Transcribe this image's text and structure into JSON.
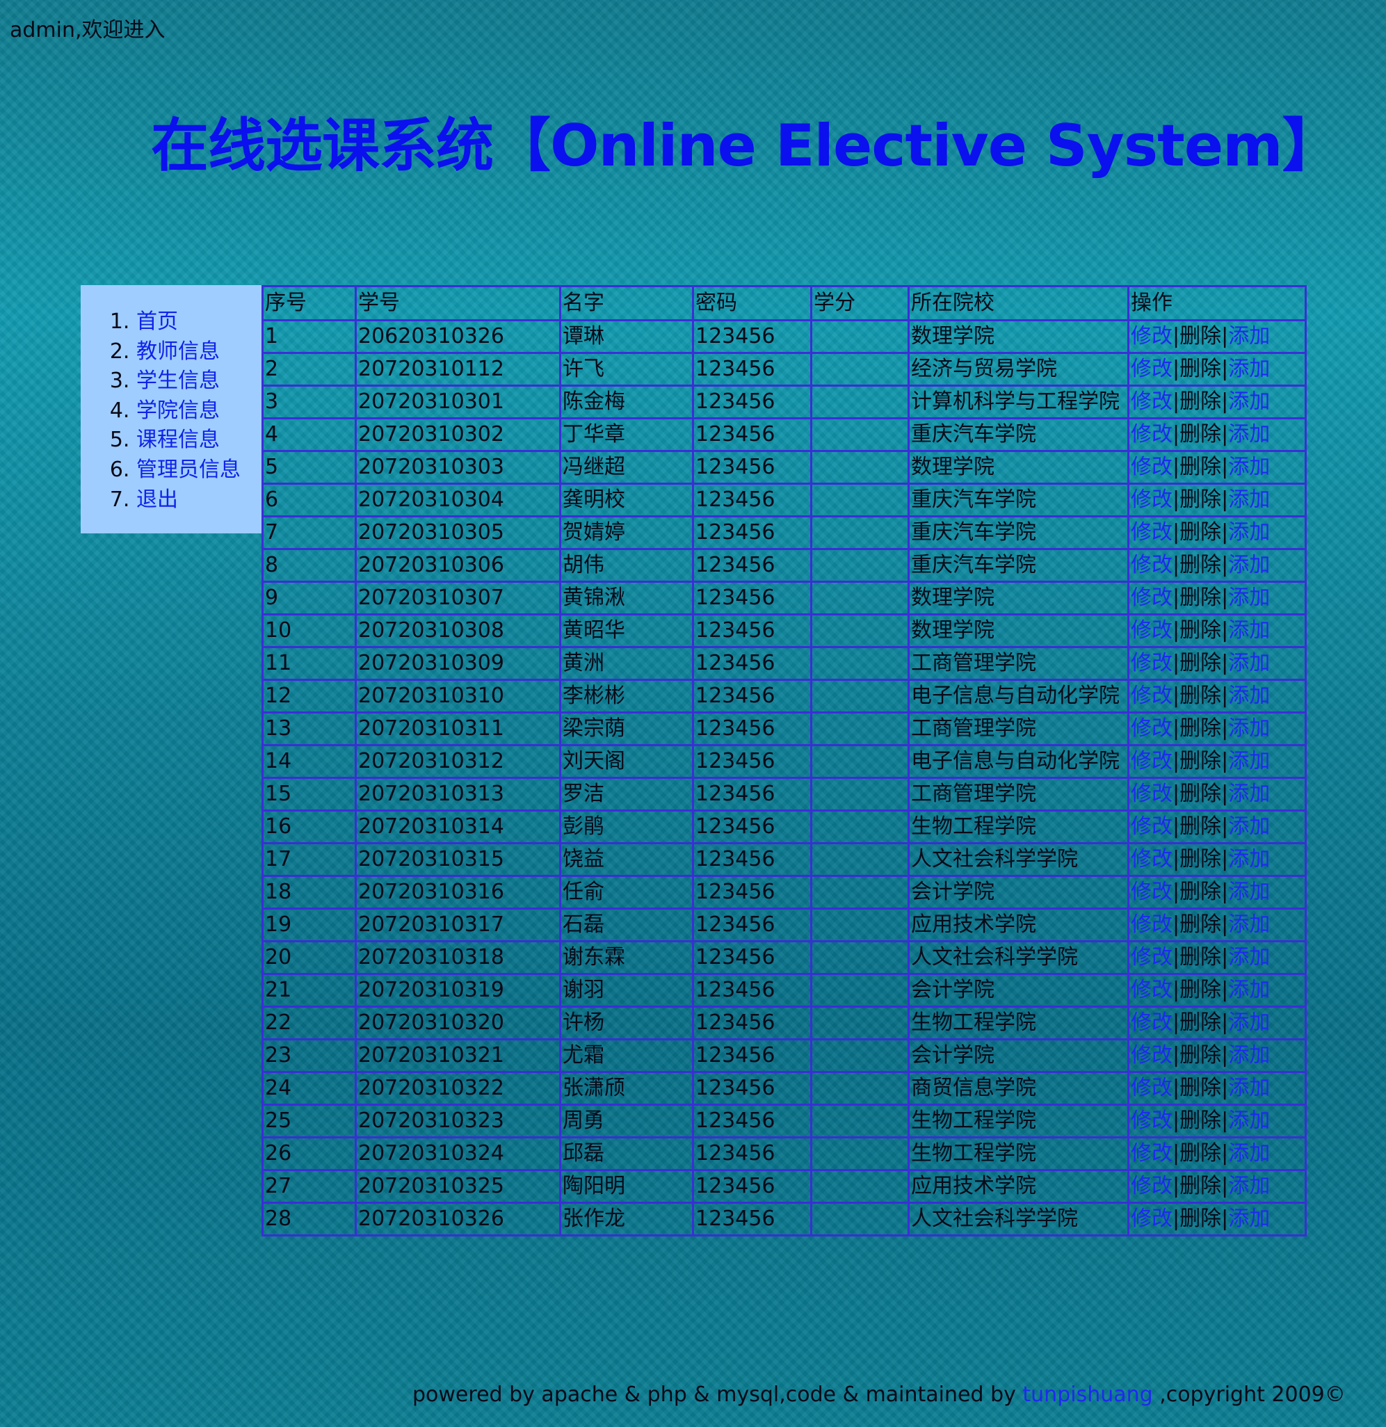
{
  "welcome_text": "admin,欢迎进入",
  "page_title": "在线选课系统【Online Elective System】",
  "sidebar": {
    "items": [
      {
        "label": "首页"
      },
      {
        "label": "教师信息"
      },
      {
        "label": "学生信息"
      },
      {
        "label": "学院信息"
      },
      {
        "label": "课程信息"
      },
      {
        "label": "管理员信息"
      },
      {
        "label": "退出"
      }
    ]
  },
  "table": {
    "headers": [
      "序号",
      "学号",
      "名字",
      "密码",
      "学分",
      "所在院校",
      "操作"
    ],
    "actions": {
      "edit": "修改",
      "separator": "|",
      "delete": "删除",
      "add": "添加"
    },
    "rows": [
      {
        "no": "1",
        "id": "20620310326",
        "name": "谭琳",
        "password": "123456",
        "credit": "",
        "college": "数理学院"
      },
      {
        "no": "2",
        "id": "20720310112",
        "name": "许飞",
        "password": "123456",
        "credit": "",
        "college": "经济与贸易学院"
      },
      {
        "no": "3",
        "id": "20720310301",
        "name": "陈金梅",
        "password": "123456",
        "credit": "",
        "college": "计算机科学与工程学院"
      },
      {
        "no": "4",
        "id": "20720310302",
        "name": "丁华章",
        "password": "123456",
        "credit": "",
        "college": "重庆汽车学院"
      },
      {
        "no": "5",
        "id": "20720310303",
        "name": "冯继超",
        "password": "123456",
        "credit": "",
        "college": "数理学院"
      },
      {
        "no": "6",
        "id": "20720310304",
        "name": "龚明校",
        "password": "123456",
        "credit": "",
        "college": "重庆汽车学院"
      },
      {
        "no": "7",
        "id": "20720310305",
        "name": "贺婧婷",
        "password": "123456",
        "credit": "",
        "college": "重庆汽车学院"
      },
      {
        "no": "8",
        "id": "20720310306",
        "name": "胡伟",
        "password": "123456",
        "credit": "",
        "college": "重庆汽车学院"
      },
      {
        "no": "9",
        "id": "20720310307",
        "name": "黄锦湫",
        "password": "123456",
        "credit": "",
        "college": "数理学院"
      },
      {
        "no": "10",
        "id": "20720310308",
        "name": "黄昭华",
        "password": "123456",
        "credit": "",
        "college": "数理学院"
      },
      {
        "no": "11",
        "id": "20720310309",
        "name": "黄洲",
        "password": "123456",
        "credit": "",
        "college": "工商管理学院"
      },
      {
        "no": "12",
        "id": "20720310310",
        "name": "李彬彬",
        "password": "123456",
        "credit": "",
        "college": "电子信息与自动化学院"
      },
      {
        "no": "13",
        "id": "20720310311",
        "name": "梁宗荫",
        "password": "123456",
        "credit": "",
        "college": "工商管理学院"
      },
      {
        "no": "14",
        "id": "20720310312",
        "name": "刘天阁",
        "password": "123456",
        "credit": "",
        "college": "电子信息与自动化学院"
      },
      {
        "no": "15",
        "id": "20720310313",
        "name": "罗洁",
        "password": "123456",
        "credit": "",
        "college": "工商管理学院"
      },
      {
        "no": "16",
        "id": "20720310314",
        "name": "彭鹃",
        "password": "123456",
        "credit": "",
        "college": "生物工程学院"
      },
      {
        "no": "17",
        "id": "20720310315",
        "name": "饶益",
        "password": "123456",
        "credit": "",
        "college": "人文社会科学学院"
      },
      {
        "no": "18",
        "id": "20720310316",
        "name": "任俞",
        "password": "123456",
        "credit": "",
        "college": "会计学院"
      },
      {
        "no": "19",
        "id": "20720310317",
        "name": "石磊",
        "password": "123456",
        "credit": "",
        "college": "应用技术学院"
      },
      {
        "no": "20",
        "id": "20720310318",
        "name": "谢东霖",
        "password": "123456",
        "credit": "",
        "college": "人文社会科学学院"
      },
      {
        "no": "21",
        "id": "20720310319",
        "name": "谢羽",
        "password": "123456",
        "credit": "",
        "college": "会计学院"
      },
      {
        "no": "22",
        "id": "20720310320",
        "name": "许杨",
        "password": "123456",
        "credit": "",
        "college": "生物工程学院"
      },
      {
        "no": "23",
        "id": "20720310321",
        "name": "尤霜",
        "password": "123456",
        "credit": "",
        "college": "会计学院"
      },
      {
        "no": "24",
        "id": "20720310322",
        "name": "张潇颀",
        "password": "123456",
        "credit": "",
        "college": "商贸信息学院"
      },
      {
        "no": "25",
        "id": "20720310323",
        "name": "周勇",
        "password": "123456",
        "credit": "",
        "college": "生物工程学院"
      },
      {
        "no": "26",
        "id": "20720310324",
        "name": "邱磊",
        "password": "123456",
        "credit": "",
        "college": "生物工程学院"
      },
      {
        "no": "27",
        "id": "20720310325",
        "name": "陶阳明",
        "password": "123456",
        "credit": "",
        "college": "应用技术学院"
      },
      {
        "no": "28",
        "id": "20720310326",
        "name": "张作龙",
        "password": "123456",
        "credit": "",
        "college": "人文社会科学学院"
      }
    ]
  },
  "footer": {
    "prefix": "powered by apache & php & mysql,code & maintained by ",
    "author_link": "tunpishuang",
    "suffix": " ,copyright 2009©"
  },
  "colors": {
    "title": "#0a10ee",
    "link": "#1d2af0",
    "sidebar_bg": "#9fcdff",
    "table_border": "#3a2fd6",
    "background": "#0f8ea3"
  }
}
